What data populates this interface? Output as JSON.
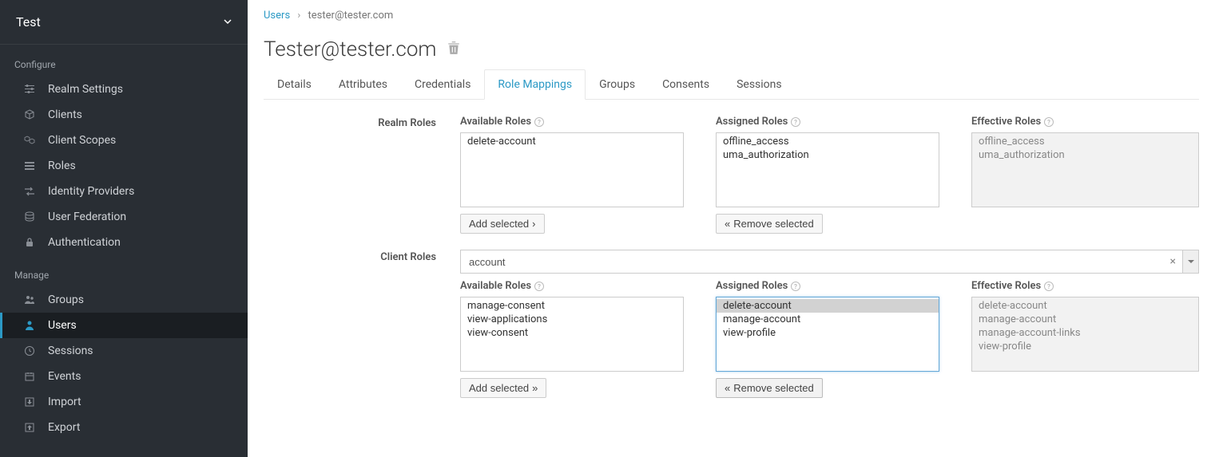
{
  "realm": {
    "name": "Test"
  },
  "sidebar": {
    "configure_label": "Configure",
    "manage_label": "Manage",
    "configure": [
      {
        "label": "Realm Settings",
        "icon": "sliders"
      },
      {
        "label": "Clients",
        "icon": "cube"
      },
      {
        "label": "Client Scopes",
        "icon": "cubes"
      },
      {
        "label": "Roles",
        "icon": "list"
      },
      {
        "label": "Identity Providers",
        "icon": "exchange"
      },
      {
        "label": "User Federation",
        "icon": "database"
      },
      {
        "label": "Authentication",
        "icon": "lock"
      }
    ],
    "manage": [
      {
        "label": "Groups",
        "icon": "users"
      },
      {
        "label": "Users",
        "icon": "user",
        "active": true
      },
      {
        "label": "Sessions",
        "icon": "clock"
      },
      {
        "label": "Events",
        "icon": "calendar"
      },
      {
        "label": "Import",
        "icon": "import"
      },
      {
        "label": "Export",
        "icon": "export"
      }
    ]
  },
  "breadcrumb": {
    "root": "Users",
    "current": "tester@tester.com"
  },
  "page": {
    "title": "Tester@tester.com"
  },
  "tabs": [
    "Details",
    "Attributes",
    "Credentials",
    "Role Mappings",
    "Groups",
    "Consents",
    "Sessions"
  ],
  "active_tab": "Role Mappings",
  "labels": {
    "realm_roles": "Realm Roles",
    "client_roles": "Client Roles",
    "available": "Available Roles",
    "assigned": "Assigned Roles",
    "effective": "Effective Roles",
    "add_selected": "Add selected",
    "remove_selected": "Remove selected"
  },
  "realm_roles": {
    "available": [
      "delete-account"
    ],
    "assigned": [
      "offline_access",
      "uma_authorization"
    ],
    "effective": [
      "offline_access",
      "uma_authorization"
    ]
  },
  "client_roles": {
    "selected_client": "account",
    "available": [
      "manage-consent",
      "view-applications",
      "view-consent"
    ],
    "assigned": [
      "delete-account",
      "manage-account",
      "view-profile"
    ],
    "assigned_selected": "delete-account",
    "effective": [
      "delete-account",
      "manage-account",
      "manage-account-links",
      "view-profile"
    ]
  }
}
